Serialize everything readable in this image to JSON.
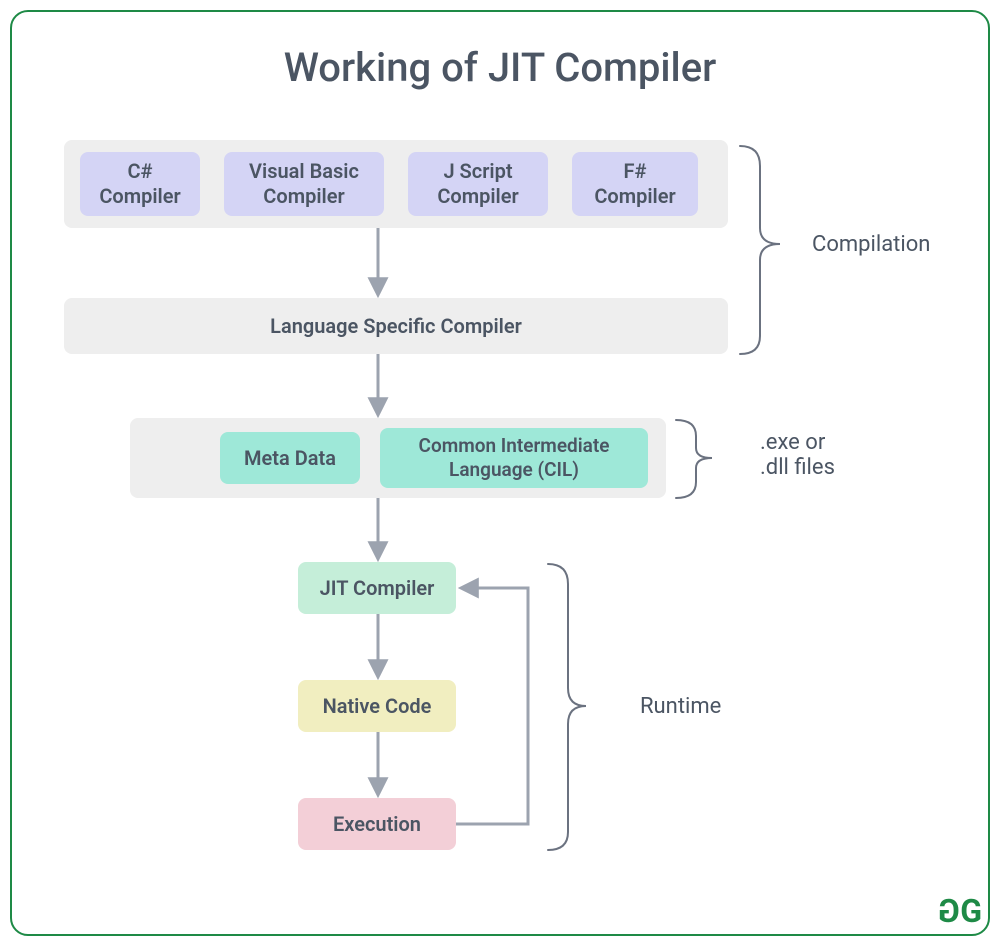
{
  "title": "Working of JIT Compiler",
  "compilers": {
    "csharp": "C#\nCompiler",
    "vb": "Visual Basic\nCompiler",
    "jscript": "J Script\nCompiler",
    "fsharp": "F#\nCompiler"
  },
  "language_specific": "Language Specific Compiler",
  "meta_data": "Meta Data",
  "cil": "Common Intermediate\nLanguage (CIL)",
  "jit": "JIT Compiler",
  "native": "Native Code",
  "execution": "Execution",
  "sections": {
    "compilation": "Compilation",
    "exe": ".exe or\n.dll files",
    "runtime": "Runtime"
  },
  "logo": "GG"
}
